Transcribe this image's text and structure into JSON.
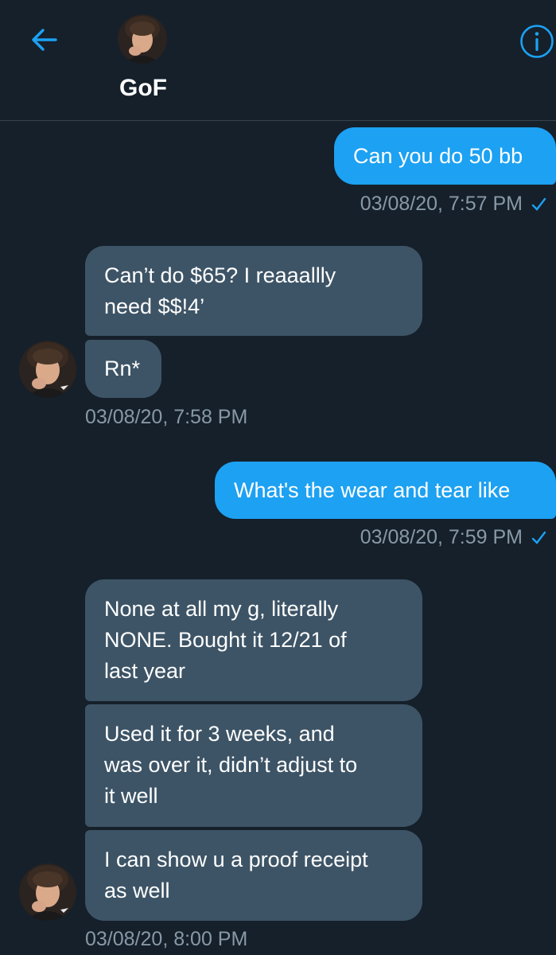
{
  "header": {
    "name": "GoF",
    "back_icon": "arrow-left-icon",
    "info_icon": "info-icon",
    "accent": "#1da1f2"
  },
  "conversation": {
    "messages": [
      {
        "direction": "outgoing",
        "text": "Can you do 50 bb"
      },
      {
        "direction": "outgoing_meta",
        "timestamp": "03/08/20, 7:57 PM",
        "status_icon": "checkmark-icon"
      },
      {
        "direction": "incoming",
        "lines": [
          "Can’t do $65? I reaaallly",
          "need $$!4’"
        ]
      },
      {
        "direction": "incoming",
        "text": "Rn*"
      },
      {
        "direction": "incoming_meta",
        "timestamp": "03/08/20, 7:58 PM"
      },
      {
        "direction": "outgoing",
        "text": "What's the wear and tear like"
      },
      {
        "direction": "outgoing_meta",
        "timestamp": "03/08/20, 7:59 PM",
        "status_icon": "checkmark-icon"
      },
      {
        "direction": "incoming",
        "lines": [
          "None at all my g, literally",
          "NONE. Bought it 12/21 of",
          "last year"
        ]
      },
      {
        "direction": "incoming",
        "lines": [
          "Used it for 3 weeks, and",
          "was over it, didn’t adjust to",
          "it well"
        ]
      },
      {
        "direction": "incoming",
        "lines": [
          "I can show u a proof receipt",
          "as well"
        ]
      },
      {
        "direction": "incoming_meta",
        "timestamp": "03/08/20, 8:00 PM"
      }
    ]
  },
  "colors": {
    "background": "#15202b",
    "outgoing_bubble": "#1da1f2",
    "incoming_bubble": "#3d5466",
    "meta_text": "#8899a6"
  }
}
